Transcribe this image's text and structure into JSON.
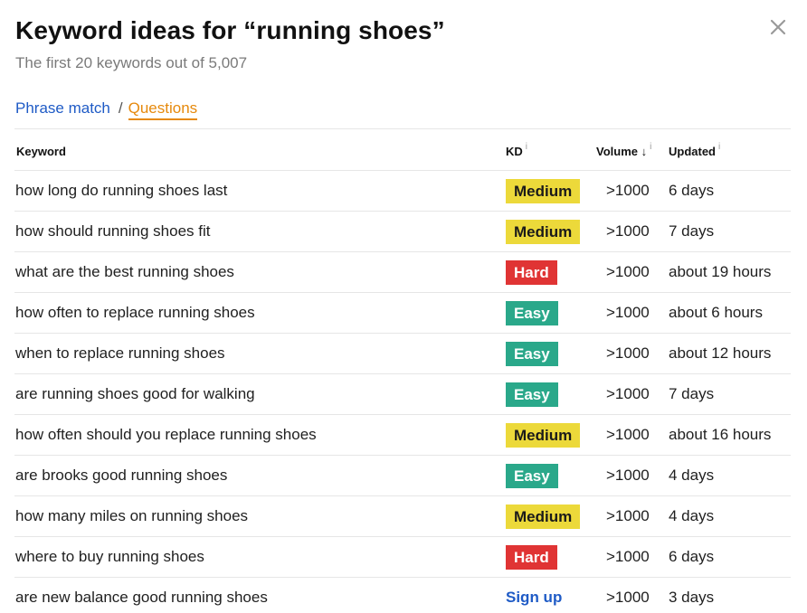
{
  "dialog": {
    "title": "Keyword ideas for “running shoes”",
    "subtitle": "The first 20 keywords out of 5,007",
    "close_icon": "close-icon"
  },
  "tabs": {
    "phrase_match": "Phrase match",
    "separator": "/",
    "questions": "Questions",
    "active": "questions"
  },
  "table": {
    "headers": {
      "keyword": "Keyword",
      "kd": "KD",
      "volume": "Volume",
      "updated": "Updated",
      "info_symbol": "i"
    },
    "rows": [
      {
        "keyword": "how long do running shoes last",
        "kd": "Medium",
        "volume": ">1000",
        "updated": "6 days"
      },
      {
        "keyword": "how should running shoes fit",
        "kd": "Medium",
        "volume": ">1000",
        "updated": "7 days"
      },
      {
        "keyword": "what are the best running shoes",
        "kd": "Hard",
        "volume": ">1000",
        "updated": "about 19 hours"
      },
      {
        "keyword": "how often to replace running shoes",
        "kd": "Easy",
        "volume": ">1000",
        "updated": "about 6 hours"
      },
      {
        "keyword": "when to replace running shoes",
        "kd": "Easy",
        "volume": ">1000",
        "updated": "about 12 hours"
      },
      {
        "keyword": "are running shoes good for walking",
        "kd": "Easy",
        "volume": ">1000",
        "updated": "7 days"
      },
      {
        "keyword": "how often should you replace running shoes",
        "kd": "Medium",
        "volume": ">1000",
        "updated": "about 16 hours"
      },
      {
        "keyword": "are brooks good running shoes",
        "kd": "Easy",
        "volume": ">1000",
        "updated": "4 days"
      },
      {
        "keyword": "how many miles on running shoes",
        "kd": "Medium",
        "volume": ">1000",
        "updated": "4 days"
      },
      {
        "keyword": "where to buy running shoes",
        "kd": "Hard",
        "volume": ">1000",
        "updated": "6 days"
      },
      {
        "keyword": "are new balance good running shoes",
        "kd": "Sign up",
        "volume": ">1000",
        "updated": "3 days"
      }
    ]
  },
  "colors": {
    "medium_bg": "#ecd93a",
    "medium_fg": "#1a1a1a",
    "hard_bg": "#e03434",
    "hard_fg": "#ffffff",
    "easy_bg": "#2aa88a",
    "easy_fg": "#ffffff",
    "link": "#1f5bc6",
    "active_tab": "#e6890c"
  }
}
